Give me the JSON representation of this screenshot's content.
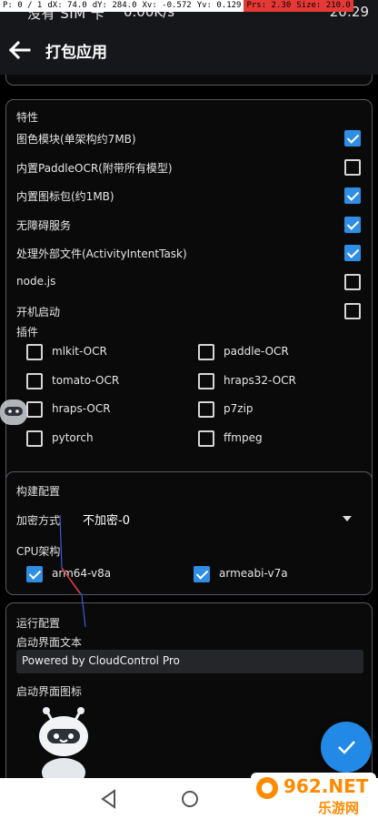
{
  "status_bar": {
    "carrier": "没有 SIM 卡",
    "speed": "0.00K/s",
    "time": "20:29"
  },
  "debug_overlay": [
    "P: 0 / 1",
    "dX: 74.0",
    "dY: 284.0",
    "Xv: -0.572",
    "Yv: 0.129",
    "Prs: 2.30",
    "Size: 210.0"
  ],
  "app_bar": {
    "title": "打包应用"
  },
  "features": {
    "header": "特性",
    "items": [
      {
        "label": "图色模块(单架构约7MB)",
        "checked": true
      },
      {
        "label": "内置PaddleOCR(附带所有模型)",
        "checked": false
      },
      {
        "label": "内置图标包(约1MB)",
        "checked": true
      },
      {
        "label": "无障碍服务",
        "checked": true
      },
      {
        "label": "处理外部文件(ActivityIntentTask)",
        "checked": true
      },
      {
        "label": "node.js",
        "checked": false
      },
      {
        "label": "开机启动",
        "checked": false
      }
    ],
    "plugins_header": "插件",
    "plugins": [
      {
        "label": "mlkit-OCR",
        "checked": false
      },
      {
        "label": "paddle-OCR",
        "checked": false
      },
      {
        "label": "tomato-OCR",
        "checked": false
      },
      {
        "label": "hraps32-OCR",
        "checked": false
      },
      {
        "label": "hraps-OCR",
        "checked": false
      },
      {
        "label": "p7zip",
        "checked": false
      },
      {
        "label": "pytorch",
        "checked": false
      },
      {
        "label": "ffmpeg",
        "checked": false
      }
    ]
  },
  "build": {
    "header": "构建配置",
    "encrypt_label": "加密方式",
    "encrypt_value": "不加密-0",
    "cpu_label": "CPU架构",
    "cpu": [
      {
        "label": "arm64-v8a",
        "checked": true
      },
      {
        "label": "armeabi-v7a",
        "checked": true
      }
    ]
  },
  "run": {
    "header": "运行配置",
    "splash_text_label": "启动界面文本",
    "splash_text_value": "Powered by CloudControl Pro",
    "splash_icon_label": "启动界面图标"
  },
  "watermark": {
    "line1": "962.NET",
    "line2": "乐游网"
  },
  "colors": {
    "accent": "#2f8de4",
    "fab": "#2389e6",
    "background": "#000000",
    "bar": "#16171a"
  }
}
